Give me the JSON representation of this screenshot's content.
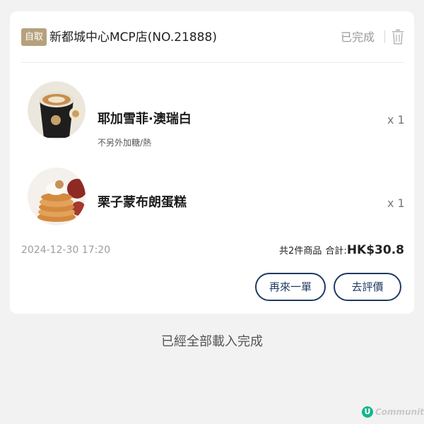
{
  "order": {
    "pickup_badge": "自取",
    "store_name": "新都城中心MCP店(NO.21888)",
    "status": "已完成",
    "items": [
      {
        "name": "耶加雪菲·澳瑞白",
        "options": "不另外加糖/熱",
        "qty": "x 1"
      },
      {
        "name": "栗子蒙布朗蛋糕",
        "options": "",
        "qty": "x 1"
      }
    ],
    "order_time": "2024-12-30 17:20",
    "item_count": "共2件商品",
    "total_label": "合計:",
    "total_value": "HK$30.8",
    "reorder_label": "再來一單",
    "review_label": "去評價"
  },
  "footer": {
    "end_text": "已經全部載入完成"
  },
  "watermark": {
    "logo_letter": "U",
    "text": "Community"
  },
  "colors": {
    "accent_navy": "#1f3a63",
    "badge_gold": "#b6a17c",
    "watermark_green": "#13b78a"
  },
  "icons": {
    "delete": "trash-icon"
  }
}
